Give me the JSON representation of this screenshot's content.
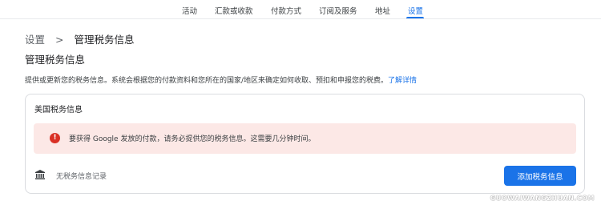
{
  "nav": {
    "tabs": [
      {
        "label": "活动"
      },
      {
        "label": "汇款或收款"
      },
      {
        "label": "付款方式"
      },
      {
        "label": "订阅及服务"
      },
      {
        "label": "地址"
      },
      {
        "label": "设置"
      }
    ],
    "active_tab": "设置"
  },
  "breadcrumb": {
    "parent": "设置",
    "separator": ">",
    "current": "管理税务信息"
  },
  "page": {
    "title": "管理税务信息",
    "description": "提供或更新您的税务信息。系统会根据您的付款资料和您所在的国家/地区来确定如何收取、预扣和申报您的税费。",
    "learn_more": "了解详情"
  },
  "card": {
    "title": "美国税务信息",
    "alert": {
      "icon": "!",
      "text": "要获得 Google 发放的付款，请务必提供您的税务信息。这需要几分钟时间。"
    },
    "no_record": "无税务信息记录",
    "add_button": "添加税务信息"
  },
  "watermark": "GUOWAIWANGZHUAN.COM",
  "colors": {
    "accent": "#1a73e8",
    "alert_bg": "#fce8e6",
    "alert_icon": "#d93025"
  }
}
